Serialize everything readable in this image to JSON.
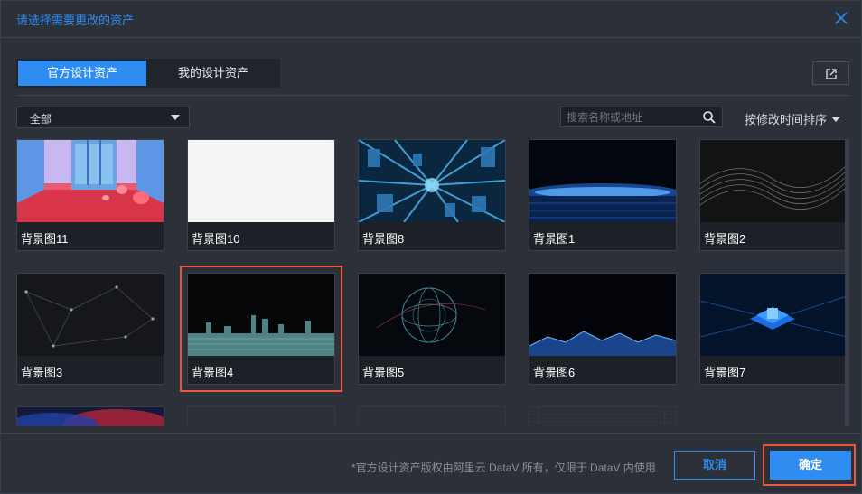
{
  "dialog": {
    "title": "请选择需要更改的资产"
  },
  "tabs": [
    {
      "label": "官方设计资产",
      "active": true
    },
    {
      "label": "我的设计资产",
      "active": false
    }
  ],
  "filter": {
    "category_selected": "全部",
    "search_placeholder": "搜索名称或地址",
    "sort_label": "按修改时间排序"
  },
  "assets": [
    {
      "label": "背景图11",
      "theme": "pink-room"
    },
    {
      "label": "背景图10",
      "theme": "white"
    },
    {
      "label": "背景图8",
      "theme": "blue-city"
    },
    {
      "label": "背景图1",
      "theme": "blue-horizon"
    },
    {
      "label": "背景图2",
      "theme": "gray-wave"
    },
    {
      "label": "背景图3",
      "theme": "network"
    },
    {
      "label": "背景图4",
      "theme": "teal-skyline",
      "selected": true
    },
    {
      "label": "背景图5",
      "theme": "globe"
    },
    {
      "label": "背景图6",
      "theme": "blue-mountains"
    },
    {
      "label": "背景图7",
      "theme": "chip"
    },
    {
      "label": "",
      "theme": "red-blue-partial"
    },
    {
      "label": "",
      "theme": "empty-partial"
    },
    {
      "label": "",
      "theme": "empty-partial"
    },
    {
      "label": "",
      "theme": "grid-partial"
    }
  ],
  "footer": {
    "note": "*官方设计资产版权由阿里云 DataV 所有，仅限于 DataV 内使用",
    "cancel_label": "取消",
    "ok_label": "确定"
  },
  "colors": {
    "accent": "#2f8cf0",
    "highlight": "#e8573d",
    "background": "#2b3039"
  }
}
